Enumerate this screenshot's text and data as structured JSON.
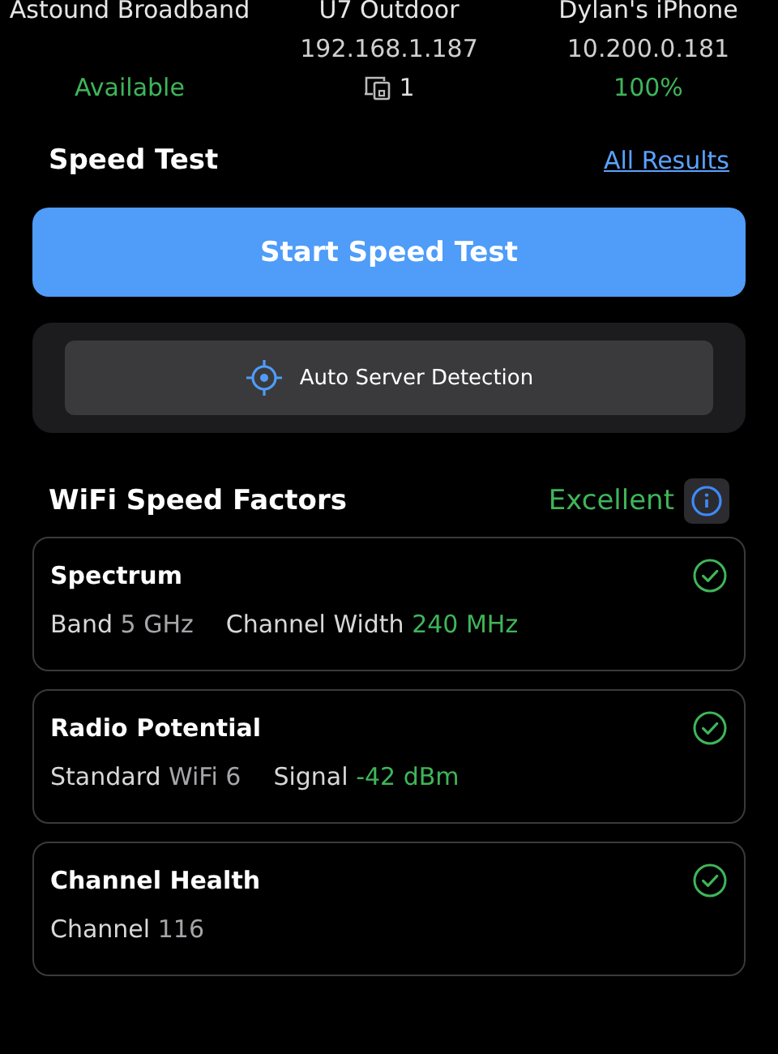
{
  "summary": [
    {
      "title": "Astound Broadband",
      "status": "Available",
      "kind": "text",
      "color": "#3fb559"
    },
    {
      "title": "U7 Outdoor",
      "detail": "192.168.1.187",
      "status": "1",
      "kind": "devices",
      "color": "#dddddd"
    },
    {
      "title": "Dylan's iPhone",
      "detail": "10.200.0.181",
      "status": "100%",
      "kind": "text",
      "color": "#3fb559"
    }
  ],
  "speed_test": {
    "title": "Speed Test",
    "link": "All Results",
    "start_button": "Start Speed Test",
    "server_button": "Auto Server Detection"
  },
  "factors": {
    "title": "WiFi Speed Factors",
    "rating": "Excellent",
    "cards": [
      {
        "title": "Spectrum",
        "passed": true,
        "metrics": [
          {
            "label": "Band",
            "value": "5 GHz",
            "color": "#a6a6aa"
          },
          {
            "label": "Channel Width",
            "value": "240 MHz",
            "color": "#3fb559"
          }
        ]
      },
      {
        "title": "Radio Potential",
        "passed": true,
        "metrics": [
          {
            "label": "Standard",
            "value": "WiFi 6",
            "color": "#a6a6aa"
          },
          {
            "label": "Signal",
            "value": "-42 dBm",
            "color": "#3fb559"
          }
        ]
      },
      {
        "title": "Channel Health",
        "passed": true,
        "metrics": [
          {
            "label": "Channel",
            "value": "116",
            "color": "#a6a6aa"
          }
        ]
      }
    ]
  }
}
